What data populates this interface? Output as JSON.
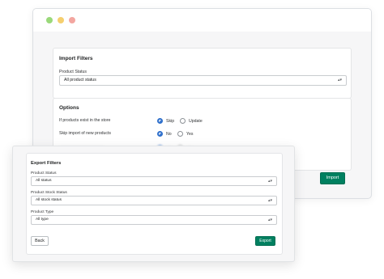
{
  "import_window": {
    "import_filters": {
      "title": "Import Filters",
      "product_status_label": "Product Status",
      "product_status_value": "All product status"
    },
    "options": {
      "title": "Options",
      "exist_label": "If products exist in the store",
      "exist_choices": [
        "Skip",
        "Update"
      ],
      "exist_selected": "Skip",
      "skip_new_label": "Skip import of new products",
      "skip_new_choices": [
        "No",
        "Yes"
      ],
      "skip_new_selected": "No"
    },
    "import_button": "Import"
  },
  "export_window": {
    "title": "Export Filters",
    "product_status_label": "Product Status",
    "product_status_value": "All status",
    "stock_status_label": "Product Stock Status",
    "stock_status_value": "All stock status",
    "product_type_label": "Product Type",
    "product_type_value": "All type",
    "back_button": "Back",
    "export_button": "Export"
  },
  "icons": {
    "select_chevron": "updown-chevron-icon"
  },
  "colors": {
    "primary_button": "#008060",
    "radio_selected": "#2c6ecb",
    "window_dot_1": "#9ad97a",
    "window_dot_2": "#f5cf6f",
    "window_dot_3": "#f3a6a0"
  }
}
